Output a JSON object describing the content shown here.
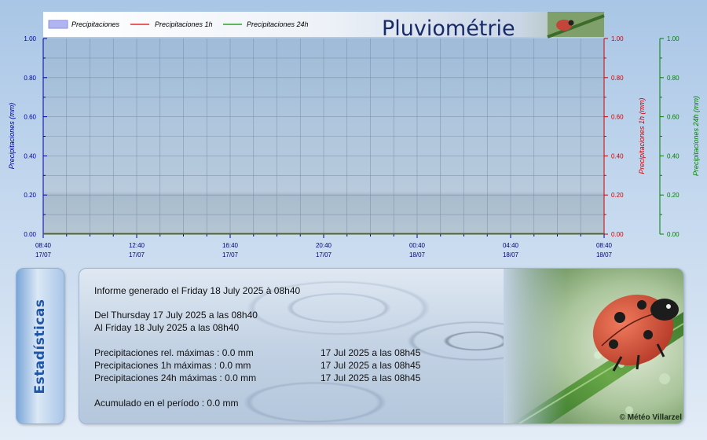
{
  "chart_data": {
    "type": "line",
    "title": "Pluviométrie",
    "legend": {
      "placement": "top",
      "items": [
        {
          "name": "Precipitaciones",
          "symbol": "box",
          "color": "#b0b4f0"
        },
        {
          "name": "Precipitaciones 1h",
          "symbol": "line",
          "color": "#e00000"
        },
        {
          "name": "Precipitaciones 24h",
          "symbol": "line",
          "color": "#009000"
        }
      ]
    },
    "x_ticks": [
      {
        "time": "08:40",
        "date": "17/07"
      },
      {
        "time": "12:40",
        "date": "17/07"
      },
      {
        "time": "16:40",
        "date": "17/07"
      },
      {
        "time": "20:40",
        "date": "17/07"
      },
      {
        "time": "00:40",
        "date": "18/07"
      },
      {
        "time": "04:40",
        "date": "18/07"
      },
      {
        "time": "08:40",
        "date": "18/07"
      }
    ],
    "x_range": [
      "2025-07-17 08:40",
      "2025-07-18 08:40"
    ],
    "axes": [
      {
        "side": "left",
        "label": "Precipitaciones (mm)",
        "color": "#0000a0",
        "range": [
          0,
          1
        ],
        "ticks": [
          "0.00",
          "0.20",
          "0.40",
          "0.60",
          "0.80",
          "1.00"
        ]
      },
      {
        "side": "right",
        "label": "Precipitaciones 1h (mm)",
        "color": "#d00000",
        "range": [
          0,
          1
        ],
        "ticks": [
          "0.00",
          "0.20",
          "0.40",
          "0.60",
          "0.80",
          "1.00"
        ]
      },
      {
        "side": "right",
        "label": "Precipitaciones 24h (mm)",
        "color": "#008000",
        "range": [
          0,
          1
        ],
        "ticks": [
          "0.00",
          "0.20",
          "0.40",
          "0.60",
          "0.80",
          "1.00"
        ]
      }
    ],
    "series": [
      {
        "name": "Precipitaciones",
        "x": [
          "2025-07-17 08:40",
          "2025-07-18 08:40"
        ],
        "values": [
          0.0,
          0.0
        ]
      },
      {
        "name": "Precipitaciones 1h",
        "x": [
          "2025-07-17 08:40",
          "2025-07-18 08:40"
        ],
        "values": [
          0.0,
          0.0
        ]
      },
      {
        "name": "Precipitaciones 24h",
        "x": [
          "2025-07-17 08:40",
          "2025-07-18 08:40"
        ],
        "values": [
          0.0,
          0.0
        ]
      }
    ],
    "grid": true
  },
  "stats": {
    "tab_label": "Estadísticas",
    "generated": "Informe generado el Friday 18 July 2025 à 08h40",
    "from": "Del Thursday 17 July 2025 a las 08h40",
    "to": "Al Friday 18 July 2025 a las 08h40",
    "rows": [
      {
        "label": "Precipitaciones rel. máximas : 0.0 mm",
        "when": "17 Jul 2025 a las 08h45"
      },
      {
        "label": "Precipitaciones 1h máximas : 0.0 mm",
        "when": "17 Jul 2025 a las 08h45"
      },
      {
        "label": "Precipitaciones 24h máximas : 0.0 mm",
        "when": "17 Jul 2025 a las 08h45"
      }
    ],
    "cumulative": "Acumulado en el período : 0.0 mm",
    "copyright": "© Météo Villarzel"
  }
}
